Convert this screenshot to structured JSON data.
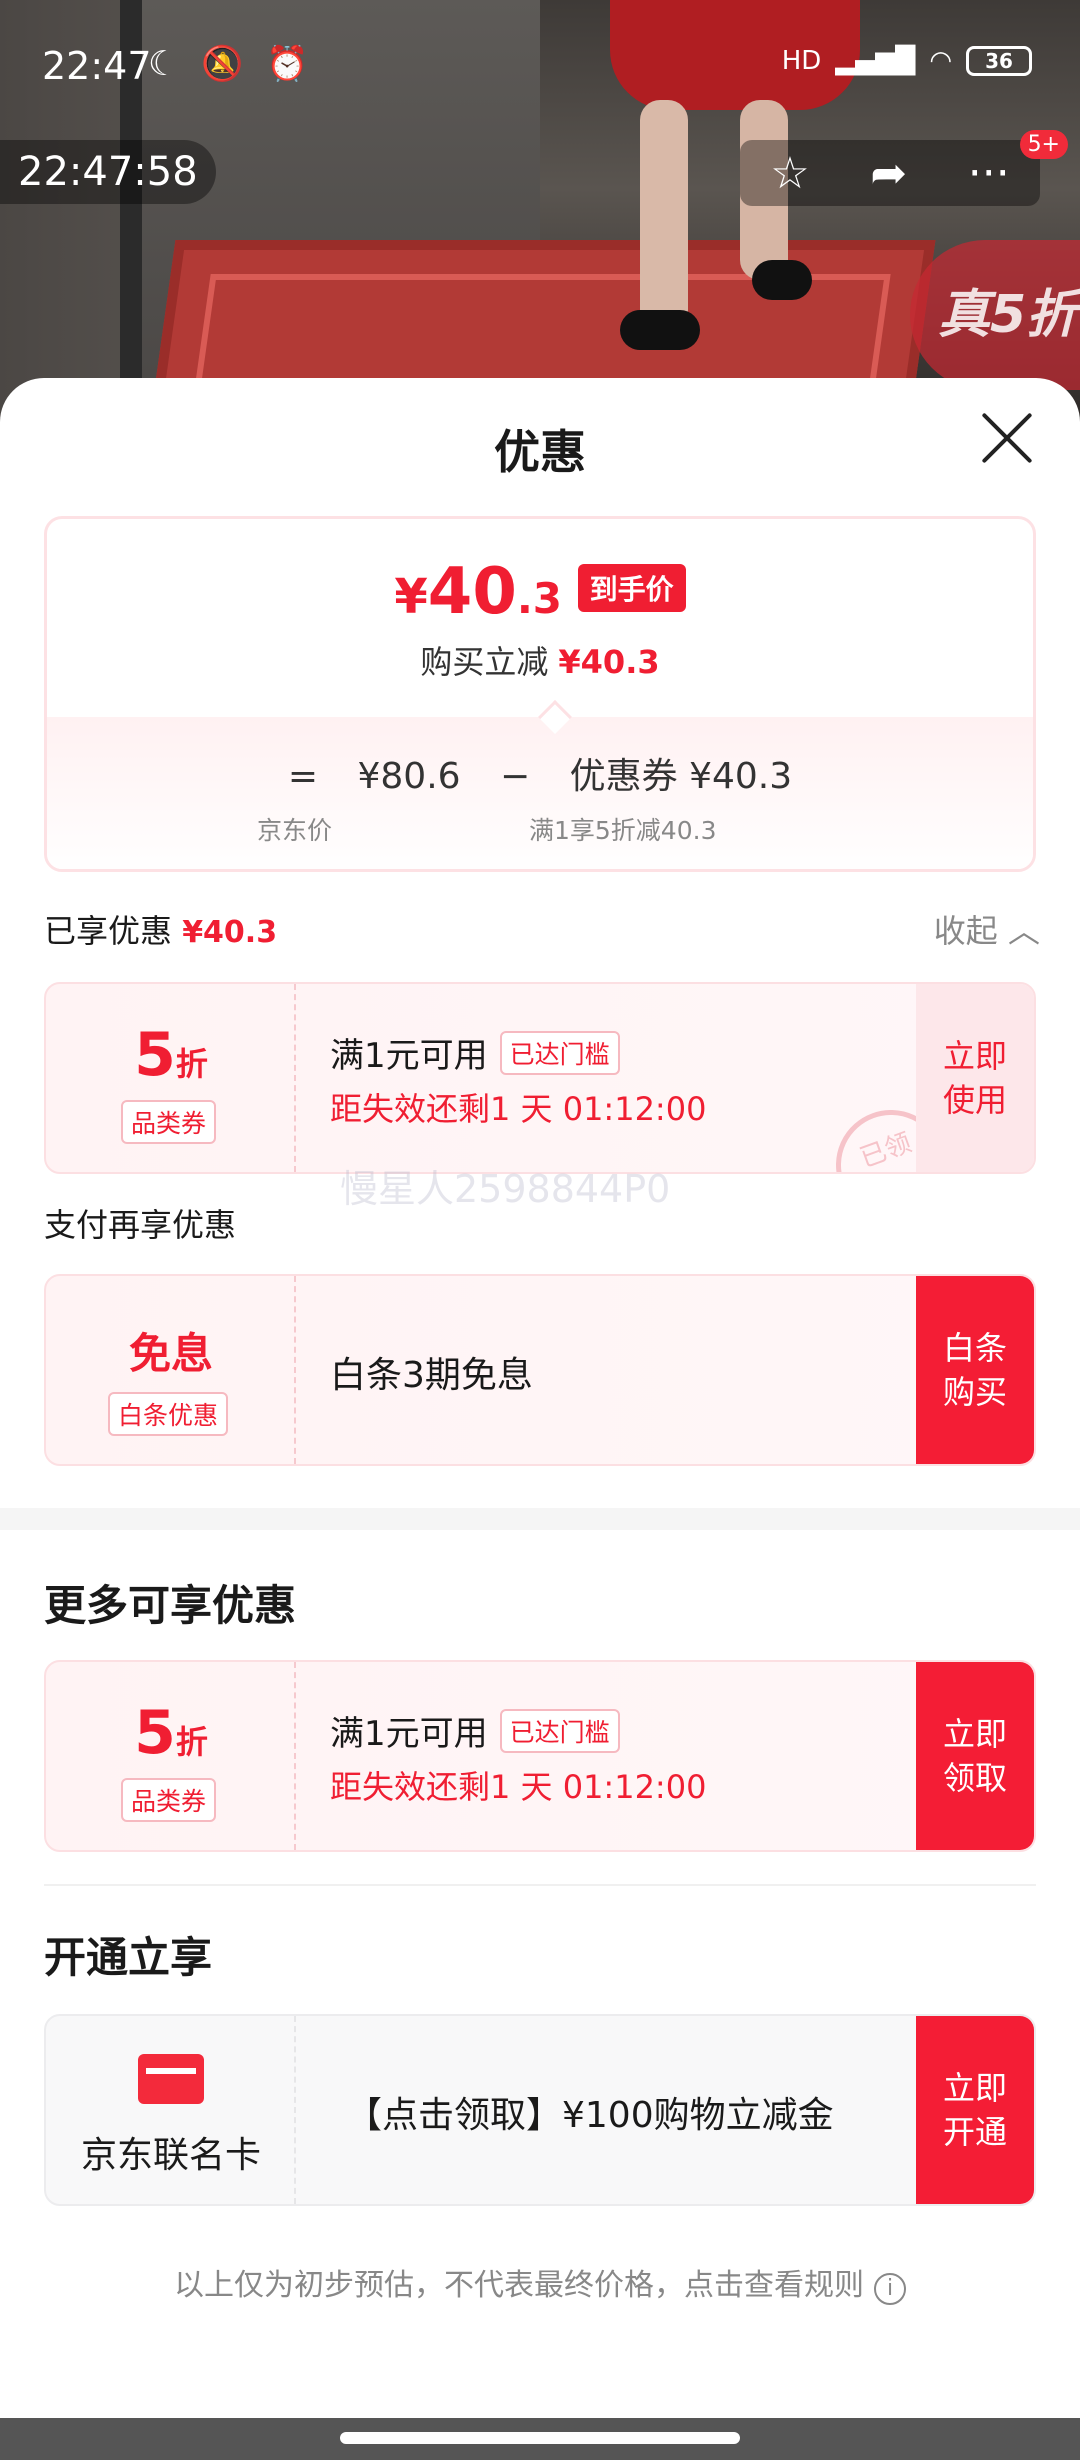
{
  "status_bar": {
    "time": "22:47",
    "battery": "36",
    "network": "HD"
  },
  "video": {
    "timer": "22:47:58",
    "badge": "5+",
    "promo_label": "真5折"
  },
  "sheet": {
    "title": "优惠"
  },
  "price": {
    "currency": "¥",
    "final_int": "40",
    "final_dec": ".3",
    "final_tag": "到手价",
    "instant_label": "购买立减",
    "instant_value": "¥40.3",
    "eq": "=",
    "jd_price": "¥80.6",
    "minus": "−",
    "coupon_label": "优惠券 ¥40.3",
    "jd_price_caption": "京东价",
    "coupon_caption": "满1享5折减40.3"
  },
  "enjoyed": {
    "label": "已享优惠",
    "value": "¥40.3",
    "collapse": "收起"
  },
  "coupon1": {
    "big": "5",
    "unit": "折",
    "type": "品类券",
    "condition": "满1元可用",
    "badge": "已达门槛",
    "expire": "距失效还剩1 天 01:12:00",
    "button": "立即\n使用",
    "stamp": "已领"
  },
  "watermark": "慢星人2598844P0",
  "pay_more": {
    "heading": "支付再享优惠"
  },
  "baitiao": {
    "big": "免息",
    "type": "白条优惠",
    "text": "白条3期免息",
    "button": "白条\n购买"
  },
  "more": {
    "title": "更多可享优惠"
  },
  "coupon2": {
    "big": "5",
    "unit": "折",
    "type": "品类券",
    "condition": "满1元可用",
    "badge": "已达门槛",
    "expire": "距失效还剩1 天 01:12:00",
    "button": "立即\n领取"
  },
  "open": {
    "title": "开通立享"
  },
  "card": {
    "name": "京东联名卡",
    "text": "【点击领取】¥100购物立减金",
    "button": "立即\n开通"
  },
  "disclaimer": "以上仅为初步预估，不代表最终价格，点击查看规则",
  "colors": {
    "accent": "#f01e32",
    "button_red": "#f41d35",
    "light_pink": "#fde7ea"
  }
}
